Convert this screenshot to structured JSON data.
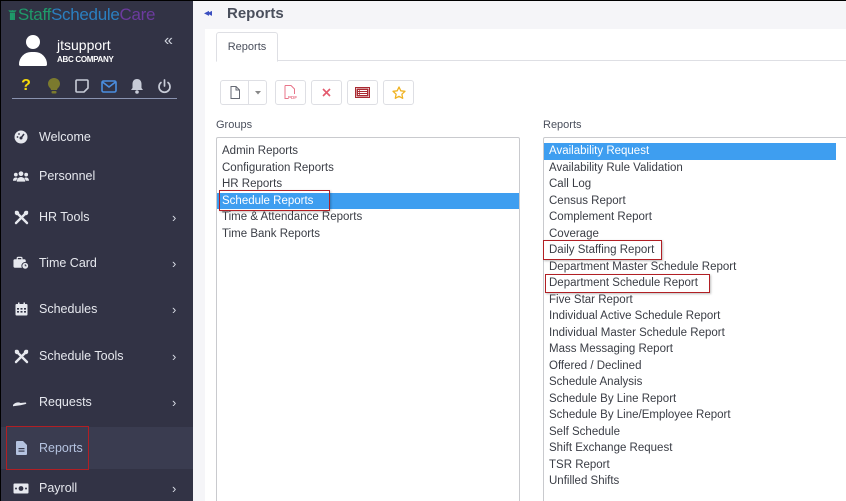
{
  "app": {
    "logo": {
      "part1": "Staff",
      "part2": "Schedule",
      "part3": "Care"
    },
    "colors": {
      "sidebar_bg": "#323345",
      "selection": "#3e9ef0",
      "highlight_box": "#b11f24",
      "accent_blue": "#3b4fc0"
    }
  },
  "user": {
    "name": "jtsupport",
    "company": "ABC COMPANY"
  },
  "quick_icons": [
    {
      "name": "help-icon",
      "glyph": "?",
      "color": "#f5d90a"
    },
    {
      "name": "lightbulb-icon",
      "glyph": "💡",
      "color": "#7a7a2a"
    },
    {
      "name": "note-icon",
      "glyph": "▢",
      "color": "#c8ccd8"
    },
    {
      "name": "mail-icon",
      "glyph": "✉",
      "color": "#4a8ee0"
    },
    {
      "name": "bell-icon",
      "glyph": "🔔",
      "color": "#c8ccd8"
    },
    {
      "name": "power-icon",
      "glyph": "⏻",
      "color": "#c8ccd8"
    }
  ],
  "sidebar": {
    "items": [
      {
        "label": "Welcome",
        "icon": "dashboard-icon",
        "glyph": "◕",
        "has_children": false
      },
      {
        "label": "Personnel",
        "icon": "users-icon",
        "glyph": "👥",
        "has_children": false
      },
      {
        "label": "HR Tools",
        "icon": "tools-icon",
        "glyph": "✂",
        "has_children": true
      },
      {
        "label": "Time Card",
        "icon": "briefcase-clock-icon",
        "glyph": "💼",
        "has_children": true
      },
      {
        "label": "Schedules",
        "icon": "calendar-icon",
        "glyph": "▦",
        "has_children": true
      },
      {
        "label": "Schedule Tools",
        "icon": "tools-icon",
        "glyph": "✂",
        "has_children": true
      },
      {
        "label": "Requests",
        "icon": "hand-icon",
        "glyph": "⌣",
        "has_children": true
      },
      {
        "label": "Reports",
        "icon": "file-icon",
        "glyph": "▤",
        "has_children": false,
        "active": true
      },
      {
        "label": "Payroll",
        "icon": "money-icon",
        "glyph": "▣",
        "has_children": true
      }
    ],
    "chevron": "›",
    "collapse": "«"
  },
  "header": {
    "title": "Reports",
    "back": "◂◂"
  },
  "tabs": [
    {
      "label": "Reports",
      "active": true
    }
  ],
  "toolbar": {
    "buttons": [
      {
        "name": "new-document-button",
        "glyph": "🗋"
      },
      {
        "name": "new-dropdown-button",
        "glyph": "▾"
      },
      {
        "name": "pdf-button",
        "glyph": "PDF"
      },
      {
        "name": "delete-button",
        "glyph": "✕"
      },
      {
        "name": "list-view-button",
        "glyph": "▤"
      },
      {
        "name": "favorite-button",
        "glyph": "☆"
      }
    ]
  },
  "groups": {
    "label": "Groups",
    "items": [
      "Admin Reports",
      "Configuration Reports",
      "HR Reports",
      "Schedule Reports",
      "Time & Attendance Reports",
      "Time Bank Reports"
    ],
    "selected": "Schedule Reports"
  },
  "reports": {
    "label": "Reports",
    "items": [
      "Availability Request",
      "Availability Rule Validation",
      "Call Log",
      "Census Report",
      "Complement Report",
      "Coverage",
      "Daily Staffing Report",
      "Department Master Schedule Report",
      "Department Schedule Report",
      "Five Star Report",
      "Individual Active Schedule Report",
      "Individual Master Schedule Report",
      "Mass Messaging Report",
      "Offered / Declined",
      "Schedule Analysis",
      "Schedule By Line Report",
      "Schedule By Line/Employee Report",
      "Self Schedule",
      "Shift Exchange Request",
      "TSR Report",
      "Unfilled Shifts"
    ],
    "selected": "Availability Request"
  }
}
